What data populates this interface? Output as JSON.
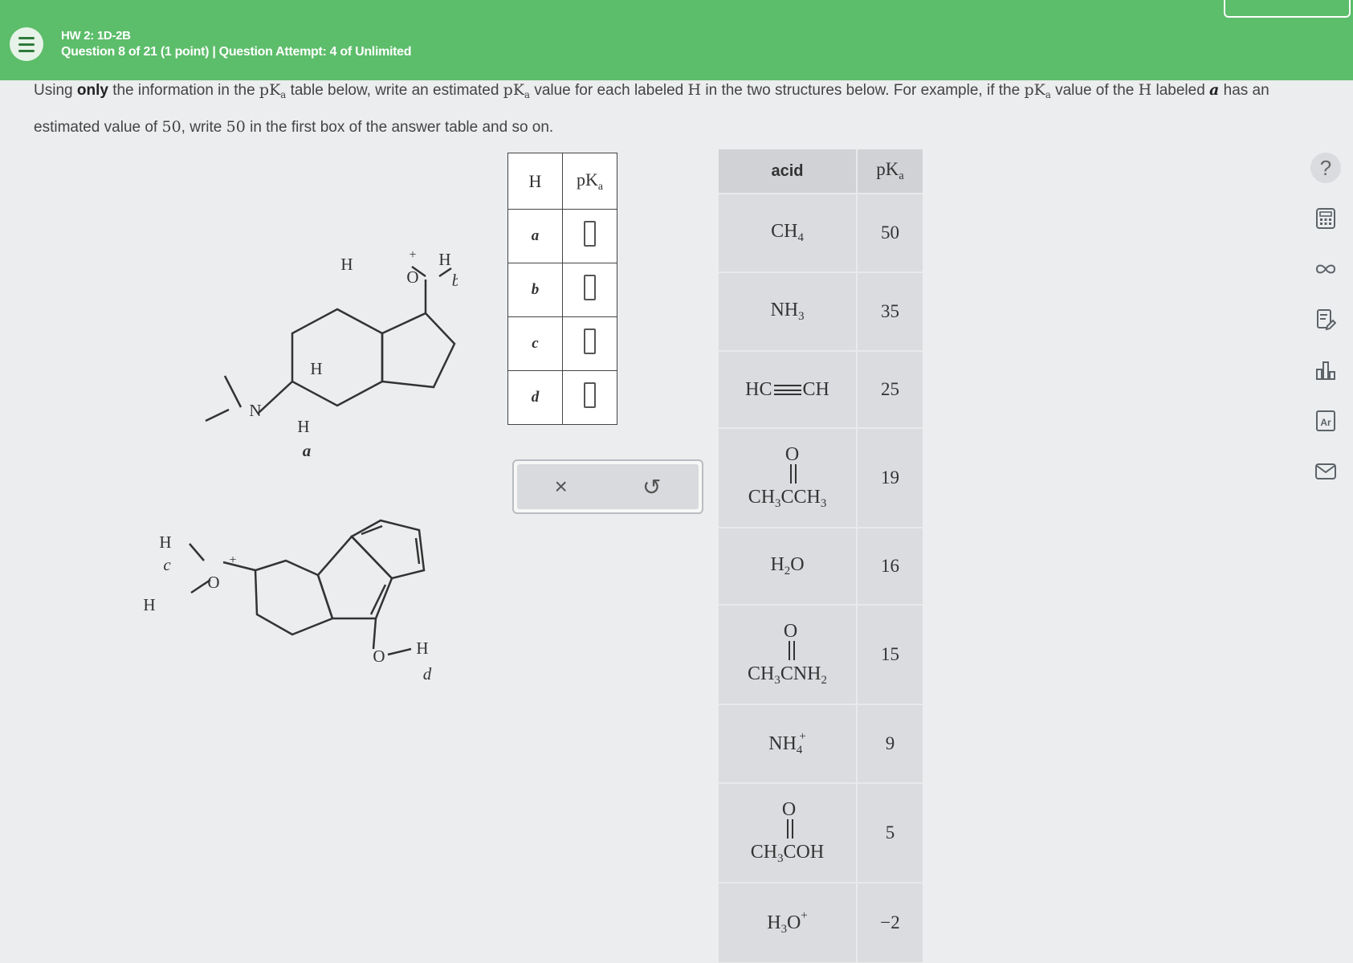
{
  "header": {
    "assignment": "HW 2: 1D-2B",
    "question_info": "Question 8 of 21 (1 point)  |  Question Attempt: 4 of Unlimited"
  },
  "prompt": {
    "p1": "Using ",
    "bold": "only",
    "p2": " the information in the ",
    "pka": "pK",
    "a": "a",
    "p3": " table below, write an estimated ",
    "p4": " value for each labeled ",
    "H": "H",
    "p5": " in the two structures below. For example, if the ",
    "p6": " value of the ",
    "p7": " labeled ",
    "label_a": "a",
    "p8": " has an estimated value of ",
    "fifty": "50",
    "p9": ", write ",
    "p10": " in the first box of the answer table and so on."
  },
  "answer_table": {
    "col_h": "H",
    "col_pk": "pK",
    "col_pk_sub": "a",
    "rows": [
      {
        "label": "a",
        "value": ""
      },
      {
        "label": "b",
        "value": ""
      },
      {
        "label": "c",
        "value": ""
      },
      {
        "label": "d",
        "value": ""
      }
    ]
  },
  "actions": {
    "clear": "×",
    "undo": "↺"
  },
  "reference_table": {
    "col_acid": "acid",
    "col_pk": "pK",
    "col_pk_sub": "a",
    "rows": [
      {
        "pk": "50"
      },
      {
        "pk": "35"
      },
      {
        "pk": "25"
      },
      {
        "pk": "19"
      },
      {
        "pk": "16"
      },
      {
        "pk": "15"
      },
      {
        "pk": "9"
      },
      {
        "pk": "5"
      },
      {
        "pk": "−2"
      }
    ]
  },
  "molecule": {
    "H": "H",
    "O": "O",
    "N": "N",
    "plus": "+",
    "lab_a": "a",
    "lab_b": "b",
    "lab_c": "c",
    "lab_d": "d"
  },
  "toolbar": {
    "help": "?",
    "periodic": "Ar"
  }
}
